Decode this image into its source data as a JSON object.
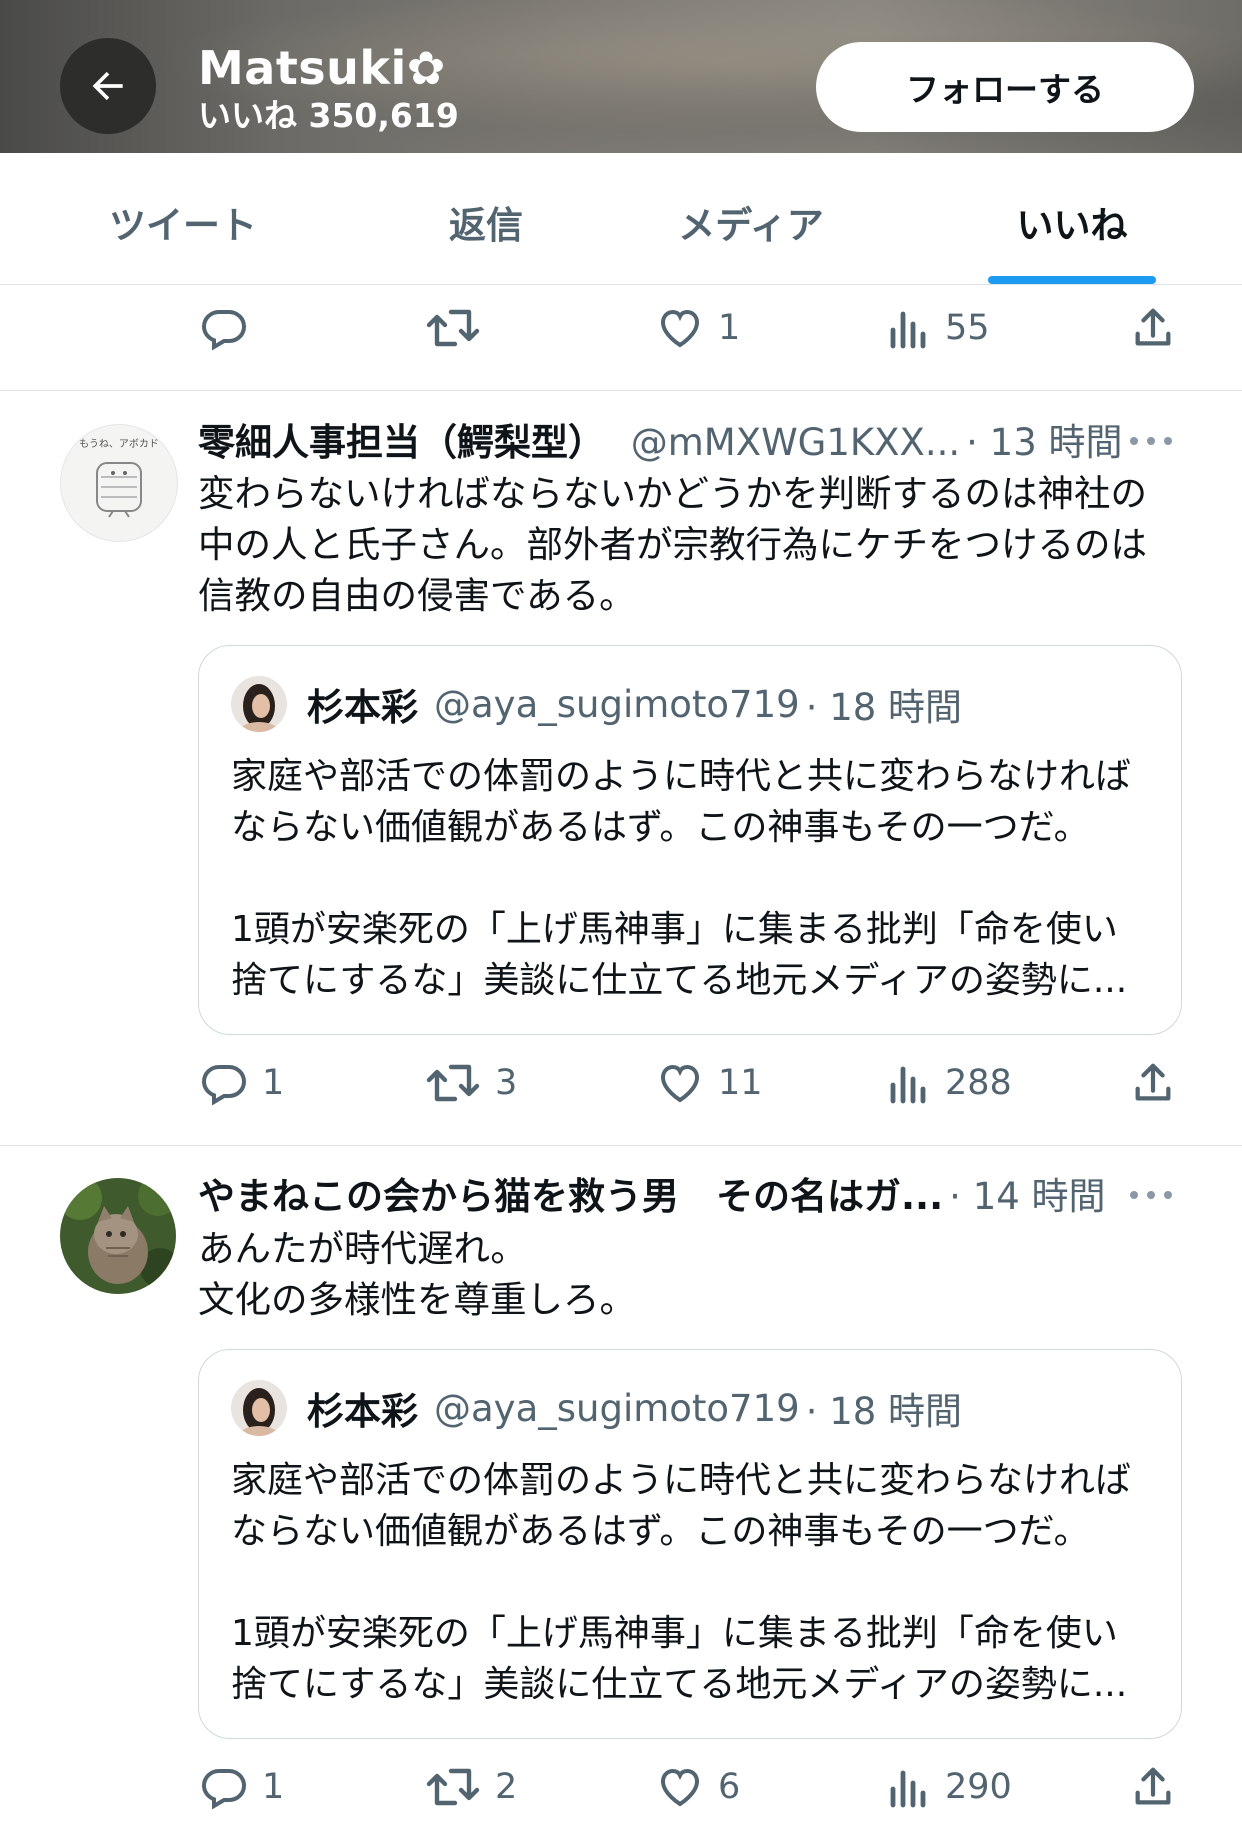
{
  "header": {
    "name": "Matsuki✿",
    "likes_line": "いいね 350,619",
    "follow_label": "フォローする",
    "back_icon": "arrow-left-icon"
  },
  "tabs": [
    {
      "label": "ツイート",
      "active": false
    },
    {
      "label": "返信",
      "active": false
    },
    {
      "label": "メディア",
      "active": false
    },
    {
      "label": "いいね",
      "active": true
    }
  ],
  "top_actions": {
    "replies": "",
    "retweets": "",
    "likes": "1",
    "views": "55"
  },
  "tweets": [
    {
      "name": "零細人事担当（鰐梨型）",
      "handle": "@mMXWG1KXX...",
      "time": "· 13 時間",
      "text": "変わらないければならないかどうかを判断するのは神社の\n中の人と氏子さん。部外者が宗教行為にケチをつけるのは\n信教の自由の侵害である。",
      "avatar_text": "もうね、アボカド",
      "quote": {
        "name": "杉本彩",
        "handle": "@aya_sugimoto719",
        "time": "· 18 時間",
        "text": "家庭や部活での体罰のように時代と共に変わらなければ\nならない価値観があるはず。この神事もその一つだ。\n\n1頭が安楽死の「上げ馬神事」に集まる批判「命を使い\n捨てにするな」美談に仕立てる地元メディアの姿勢に..."
      },
      "actions": {
        "replies": "1",
        "retweets": "3",
        "likes": "11",
        "views": "288"
      }
    },
    {
      "name": "やまねこの会から猫を救う男　その名はガ...",
      "handle": "",
      "time": "· 14 時間",
      "text": "あんたが時代遅れ。\n文化の多様性を尊重しろ。",
      "quote": {
        "name": "杉本彩",
        "handle": "@aya_sugimoto719",
        "time": "· 18 時間",
        "text": "家庭や部活での体罰のように時代と共に変わらなければ\nならない価値観があるはず。この神事もその一つだ。\n\n1頭が安楽死の「上げ馬神事」に集まる批判「命を使い\n捨てにするな」美談に仕立てる地元メディアの姿勢に..."
      },
      "actions": {
        "replies": "1",
        "retweets": "2",
        "likes": "6",
        "views": "290"
      }
    }
  ],
  "colors": {
    "accent": "#1d9bf0",
    "text": "#0f1419",
    "muted": "#536471",
    "border": "#cfd9de"
  }
}
